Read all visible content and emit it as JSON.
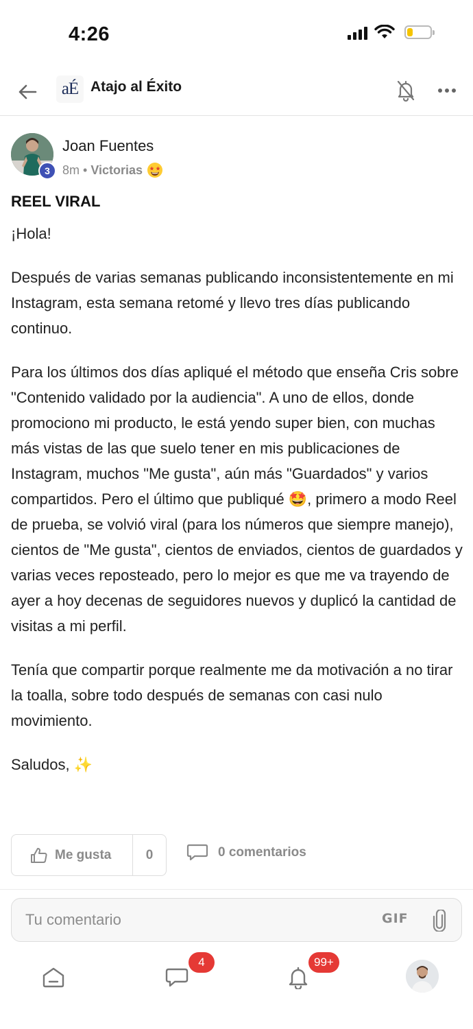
{
  "status_bar": {
    "time": "4:26",
    "signal_icon": "cellular-signal-icon",
    "wifi_icon": "wifi-icon",
    "battery_icon": "battery-low-icon",
    "battery_level": 0.25,
    "battery_color": "#f5c400"
  },
  "header": {
    "back_icon": "arrow-left-icon",
    "logo_text": "aÉ",
    "title": "Atajo al Éxito",
    "notifications_off_icon": "bell-off-icon",
    "more_icon": "more-horizontal-icon"
  },
  "post": {
    "author": {
      "name": "Joan Fuentes",
      "level": "3",
      "level_color": "#3f51b5"
    },
    "time_ago": "8m",
    "separator": "•",
    "category": "Victorias",
    "category_emoji": "star-struck-emoji",
    "title": "REEL VIRAL",
    "paragraphs": [
      "¡Hola!",
      "Después de varias semanas publicando inconsistentemente en mi Instagram, esta semana retomé y llevo tres días publicando continuo.",
      "Para los últimos dos días apliqué el método que enseña Cris sobre \"Contenido validado por la audiencia\". A uno de ellos, donde promociono mi producto, le está yendo super bien, con muchas más vistas de las que suelo tener en mis publicaciones de Instagram, muchos \"Me gusta\", aún más \"Guardados\" y varios compartidos. Pero el último que publiqué 🤩, primero a modo Reel de prueba, se volvió viral (para los números que siempre manejo), cientos de \"Me gusta\", cientos de enviados, cientos de guardados y varias veces reposteado, pero lo mejor es que me va trayendo de ayer a hoy decenas de seguidores nuevos y duplicó la cantidad de visitas a mi perfil.",
      "Tenía que compartir porque realmente me da motivación a no tirar la toalla, sobre todo después de semanas con casi nulo movimiento.",
      "Saludos, ✨"
    ]
  },
  "actions": {
    "like_icon": "thumbs-up-icon",
    "like_label": "Me gusta",
    "like_count": "0",
    "comment_icon": "comment-bubble-icon",
    "comments_label": "0 comentarios"
  },
  "composer": {
    "placeholder": "Tu comentario",
    "gif_label": "GIF",
    "attach_icon": "paperclip-icon"
  },
  "bottom_nav": {
    "home_icon": "home-icon",
    "chat_icon": "chat-icon",
    "chat_badge": "4",
    "notifications_icon": "bell-icon",
    "notifications_badge": "99+",
    "profile_icon": "profile-avatar",
    "badge_color": "#e53935"
  }
}
